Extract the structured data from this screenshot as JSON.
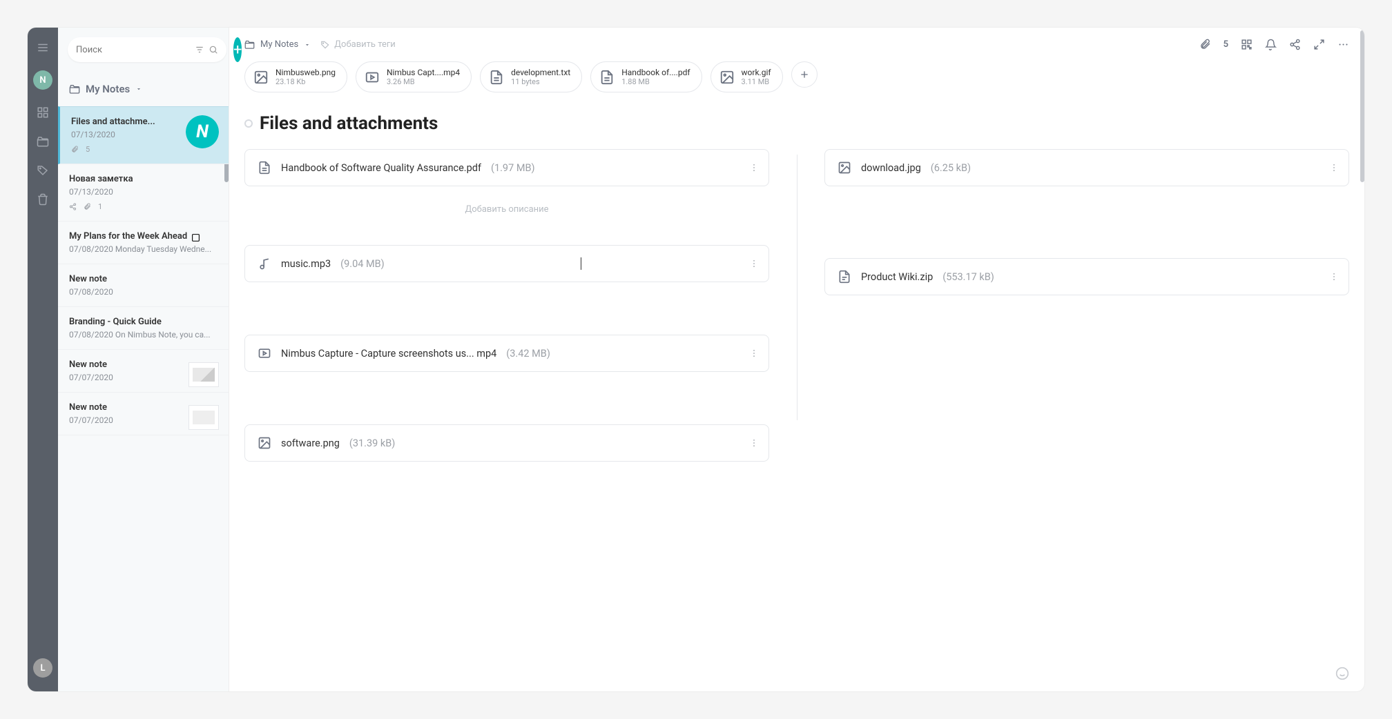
{
  "search": {
    "placeholder": "Поиск"
  },
  "folder": {
    "name": "My Notes"
  },
  "notes": [
    {
      "title": "Files and attachme...",
      "date": "07/13/2020",
      "att": "5"
    },
    {
      "title": "Новая заметка",
      "date": "07/13/2020",
      "shared": "1"
    },
    {
      "title": "My Plans for the Week Ahead",
      "date": "07/08/2020",
      "excerpt": "Monday Tuesday Wedne..."
    },
    {
      "title": "New note",
      "date": "07/08/2020"
    },
    {
      "title": "Branding - Quick Guide",
      "date": "07/08/2020",
      "excerpt": "On Nimbus Note, you ca..."
    },
    {
      "title": "New note",
      "date": "07/07/2020"
    },
    {
      "title": "New note",
      "date": "07/07/2020"
    }
  ],
  "breadcrumb": "My Notes",
  "tags_placeholder": "Добавить теги",
  "attach_count": "5",
  "chips": [
    {
      "name": "Nimbusweb.png",
      "size": "23.18 Kb",
      "icon": "image"
    },
    {
      "name": "Nimbus Capt....mp4",
      "size": "3.26 MB",
      "icon": "video"
    },
    {
      "name": "development.txt",
      "size": "11 bytes",
      "icon": "file"
    },
    {
      "name": "Handbook of....pdf",
      "size": "1.88 MB",
      "icon": "file"
    },
    {
      "name": "work.gif",
      "size": "3.11 MB",
      "icon": "image"
    }
  ],
  "page_title": "Files and attachments",
  "left_cards": [
    {
      "name": "Handbook of Software Quality Assurance.pdf",
      "size": "(1.97 MB)",
      "icon": "file"
    },
    {
      "name": "music.mp3",
      "size": "(9.04 MB)",
      "icon": "music"
    },
    {
      "name": "Nimbus Capture - Capture screenshots us... mp4",
      "size": "(3.42 MB)",
      "icon": "video"
    },
    {
      "name": "software.png",
      "size": "(31.39 kB)",
      "icon": "image"
    }
  ],
  "right_cards": [
    {
      "name": "download.jpg",
      "size": "(6.25 kB)",
      "icon": "image"
    },
    {
      "name": "Product Wiki.zip",
      "size": "(553.17 kB)",
      "icon": "archive"
    }
  ],
  "desc_placeholder": "Добавить описание"
}
